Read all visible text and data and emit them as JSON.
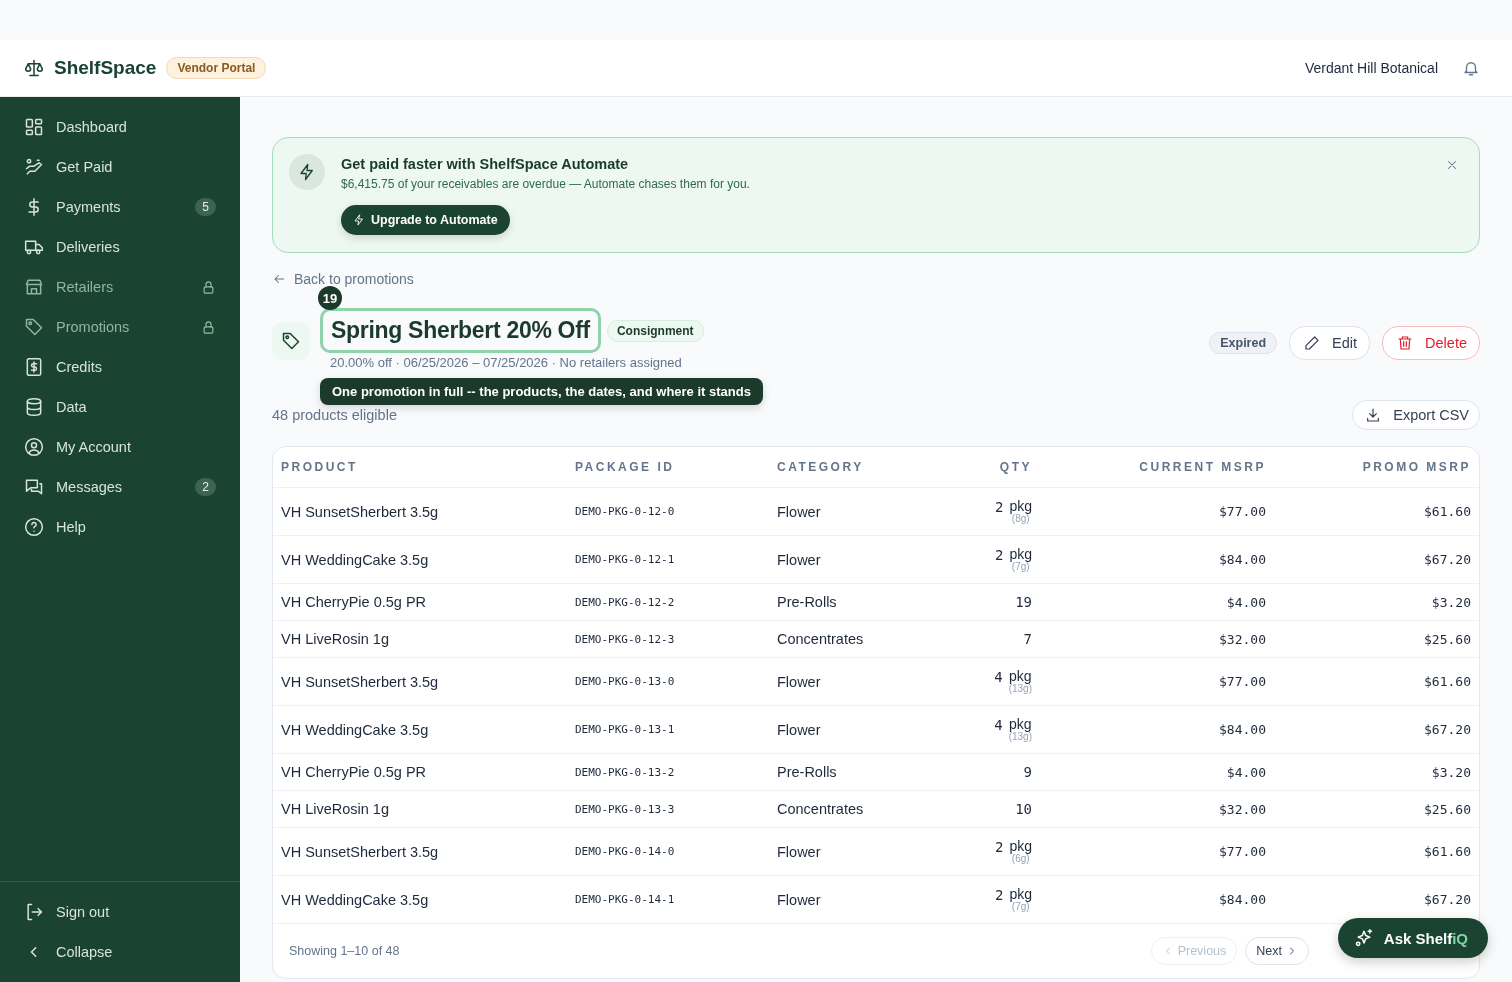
{
  "header": {
    "brand": "ShelfSpace",
    "portal_badge": "Vendor Portal",
    "account": "Verdant Hill Botanical"
  },
  "sidebar": {
    "items": [
      {
        "label": "Dashboard",
        "locked": false
      },
      {
        "label": "Get Paid",
        "locked": false
      },
      {
        "label": "Payments",
        "locked": false,
        "badge": "5"
      },
      {
        "label": "Deliveries",
        "locked": false
      },
      {
        "label": "Retailers",
        "locked": true
      },
      {
        "label": "Promotions",
        "locked": true
      },
      {
        "label": "Credits",
        "locked": false
      },
      {
        "label": "Data",
        "locked": false
      },
      {
        "label": "My Account",
        "locked": false
      },
      {
        "label": "Messages",
        "locked": false,
        "badge": "2"
      },
      {
        "label": "Help",
        "locked": false
      }
    ],
    "footer": [
      "Sign out",
      "Collapse"
    ]
  },
  "banner": {
    "title": "Get paid faster with ShelfSpace Automate",
    "text": "$6,415.75 of your receivables are overdue — Automate chases them for you.",
    "button": "Upgrade to Automate"
  },
  "back_link": "Back to promotions",
  "promotion": {
    "title": "Spring Sherbert 20% Off",
    "type_badge": "Consignment",
    "subtitle": "20.00% off · 06/25/2026 – 07/25/2026 · No retailers assigned",
    "status": "Expired",
    "actions": [
      "Edit",
      "Delete"
    ]
  },
  "annotation": {
    "number": "19",
    "tooltip": "One promotion in full -- the products, the dates, and where it stands"
  },
  "eligible": "48 products eligible",
  "export_button": "Export CSV",
  "table": {
    "columns": [
      "PRODUCT",
      "PACKAGE ID",
      "CATEGORY",
      "QTY",
      "CURRENT MSRP",
      "PROMO MSRP"
    ],
    "rows": [
      {
        "product": "VH SunsetSherbert 3.5g",
        "package_id": "DEMO-PKG-0-12-0",
        "category": "Flower",
        "qty": "2",
        "unit": "pkg",
        "weight": "(8g)",
        "current": "$77.00",
        "promo": "$61.60"
      },
      {
        "product": "VH WeddingCake 3.5g",
        "package_id": "DEMO-PKG-0-12-1",
        "category": "Flower",
        "qty": "2",
        "unit": "pkg",
        "weight": "(7g)",
        "current": "$84.00",
        "promo": "$67.20"
      },
      {
        "product": "VH CherryPie 0.5g PR",
        "package_id": "DEMO-PKG-0-12-2",
        "category": "Pre-Rolls",
        "qty": "19",
        "current": "$4.00",
        "promo": "$3.20"
      },
      {
        "product": "VH LiveRosin 1g",
        "package_id": "DEMO-PKG-0-12-3",
        "category": "Concentrates",
        "qty": "7",
        "current": "$32.00",
        "promo": "$25.60"
      },
      {
        "product": "VH SunsetSherbert 3.5g",
        "package_id": "DEMO-PKG-0-13-0",
        "category": "Flower",
        "qty": "4",
        "unit": "pkg",
        "weight": "(13g)",
        "current": "$77.00",
        "promo": "$61.60"
      },
      {
        "product": "VH WeddingCake 3.5g",
        "package_id": "DEMO-PKG-0-13-1",
        "category": "Flower",
        "qty": "4",
        "unit": "pkg",
        "weight": "(13g)",
        "current": "$84.00",
        "promo": "$67.20"
      },
      {
        "product": "VH CherryPie 0.5g PR",
        "package_id": "DEMO-PKG-0-13-2",
        "category": "Pre-Rolls",
        "qty": "9",
        "current": "$4.00",
        "promo": "$3.20"
      },
      {
        "product": "VH LiveRosin 1g",
        "package_id": "DEMO-PKG-0-13-3",
        "category": "Concentrates",
        "qty": "10",
        "current": "$32.00",
        "promo": "$25.60"
      },
      {
        "product": "VH SunsetSherbert 3.5g",
        "package_id": "DEMO-PKG-0-14-0",
        "category": "Flower",
        "qty": "2",
        "unit": "pkg",
        "weight": "(6g)",
        "current": "$77.00",
        "promo": "$61.60"
      },
      {
        "product": "VH WeddingCake 3.5g",
        "package_id": "DEMO-PKG-0-14-1",
        "category": "Flower",
        "qty": "2",
        "unit": "pkg",
        "weight": "(7g)",
        "current": "$84.00",
        "promo": "$67.20"
      }
    ]
  },
  "pagination": {
    "summary": "Showing 1–10 of 48",
    "previous": {
      "label": "Previous",
      "disabled": true
    },
    "next": {
      "label": "Next",
      "disabled": false
    }
  },
  "assistant": {
    "label": "Ask Shelf",
    "accent": "iQ"
  }
}
